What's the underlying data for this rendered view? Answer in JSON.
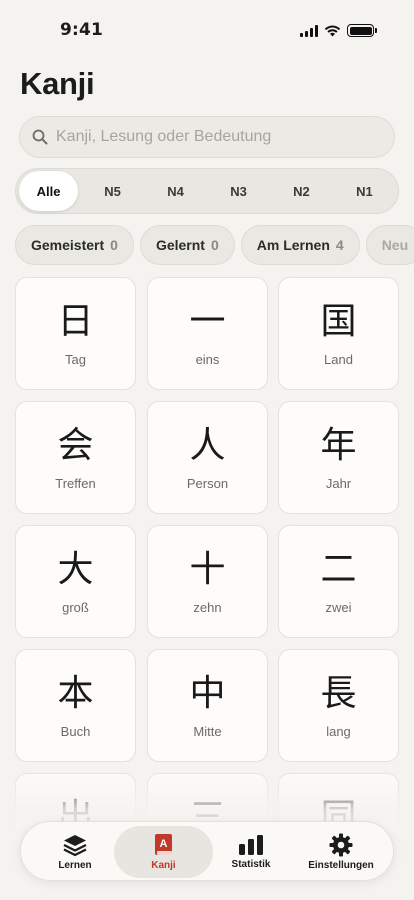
{
  "status_bar": {
    "time": "9:41"
  },
  "title": "Kanji",
  "search": {
    "placeholder": "Kanji, Lesung oder Bedeutung",
    "value": ""
  },
  "levels": [
    {
      "label": "Alle",
      "active": true
    },
    {
      "label": "N5"
    },
    {
      "label": "N4"
    },
    {
      "label": "N3"
    },
    {
      "label": "N2"
    },
    {
      "label": "N1"
    }
  ],
  "filters": [
    {
      "label": "Gemeistert",
      "count": "0"
    },
    {
      "label": "Gelernt",
      "count": "0"
    },
    {
      "label": "Am Lernen",
      "count": "4"
    },
    {
      "label": "Neu",
      "count": ""
    }
  ],
  "kanji": [
    {
      "char": "日",
      "meaning": "Tag"
    },
    {
      "char": "一",
      "meaning": "eins"
    },
    {
      "char": "国",
      "meaning": "Land"
    },
    {
      "char": "会",
      "meaning": "Treffen"
    },
    {
      "char": "人",
      "meaning": "Person"
    },
    {
      "char": "年",
      "meaning": "Jahr"
    },
    {
      "char": "大",
      "meaning": "groß"
    },
    {
      "char": "十",
      "meaning": "zehn"
    },
    {
      "char": "二",
      "meaning": "zwei"
    },
    {
      "char": "本",
      "meaning": "Buch"
    },
    {
      "char": "中",
      "meaning": "Mitte"
    },
    {
      "char": "長",
      "meaning": "lang"
    },
    {
      "char": "出",
      "meaning": ""
    },
    {
      "char": "三",
      "meaning": ""
    },
    {
      "char": "同",
      "meaning": ""
    }
  ],
  "tabs": [
    {
      "label": "Lernen",
      "icon": "layers-icon"
    },
    {
      "label": "Kanji",
      "icon": "kanji-book-icon",
      "active": true
    },
    {
      "label": "Statistik",
      "icon": "bar-chart-icon"
    },
    {
      "label": "Einstellungen",
      "icon": "gear-icon"
    }
  ],
  "colors": {
    "accent": "#c0392b",
    "background": "#f4f3ef",
    "card": "#fdfcfa"
  }
}
